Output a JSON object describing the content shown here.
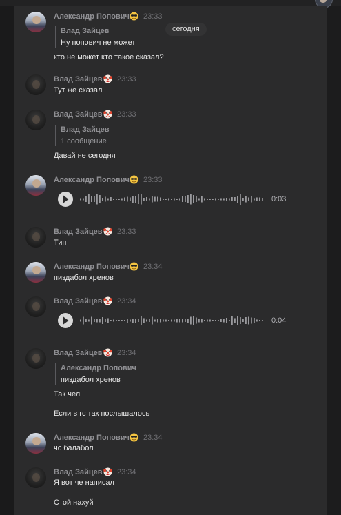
{
  "date_label": "сегодня",
  "users": {
    "alex": {
      "name": "Александр Попович",
      "emoji": "sunglasses-emoji"
    },
    "vlad": {
      "name": "Влад Зайцев",
      "emoji": "clown-emoji"
    }
  },
  "messages": [
    {
      "author": "Александр Попович",
      "time": "23:33",
      "reply": {
        "author": "Влад Зайцев",
        "text": "Ну попович не может"
      },
      "lines": [
        "кто не может кто такое сказал?"
      ]
    },
    {
      "author": "Влад Зайцев",
      "time": "23:33",
      "lines": [
        "Тут же сказал"
      ]
    },
    {
      "author": "Влад Зайцев",
      "time": "23:33",
      "reply": {
        "author": "Влад Зайцев",
        "text": "1 сообщение"
      },
      "lines": [
        "Давай не сегодня"
      ]
    },
    {
      "author": "Александр Попович",
      "time": "23:33",
      "voice": {
        "duration": "0:03"
      }
    },
    {
      "author": "Влад Зайцев",
      "time": "23:33",
      "lines": [
        "Тип"
      ]
    },
    {
      "author": "Александр Попович",
      "time": "23:34",
      "lines": [
        "пиздабол хренов"
      ]
    },
    {
      "author": "Влад Зайцев",
      "time": "23:34",
      "voice": {
        "duration": "0:04"
      }
    },
    {
      "author": "Влад Зайцев",
      "time": "23:34",
      "reply": {
        "author": "Александр Попович",
        "text": "пиздабол хренов"
      },
      "lines": [
        "Так чел",
        "Если в гс так послышалось"
      ]
    },
    {
      "author": "Александр Попович",
      "time": "23:34",
      "lines": [
        "чс балабол"
      ]
    },
    {
      "author": "Влад Зайцев",
      "time": "23:34",
      "lines": [
        "Я вот че написал",
        "Стой нахуй"
      ]
    }
  ],
  "colors": {
    "background": "#2b2b2c",
    "text": "#e7e7e7",
    "name": "#8f8f93",
    "time": "#6e6e72",
    "waveform": "#9a9a9e"
  }
}
